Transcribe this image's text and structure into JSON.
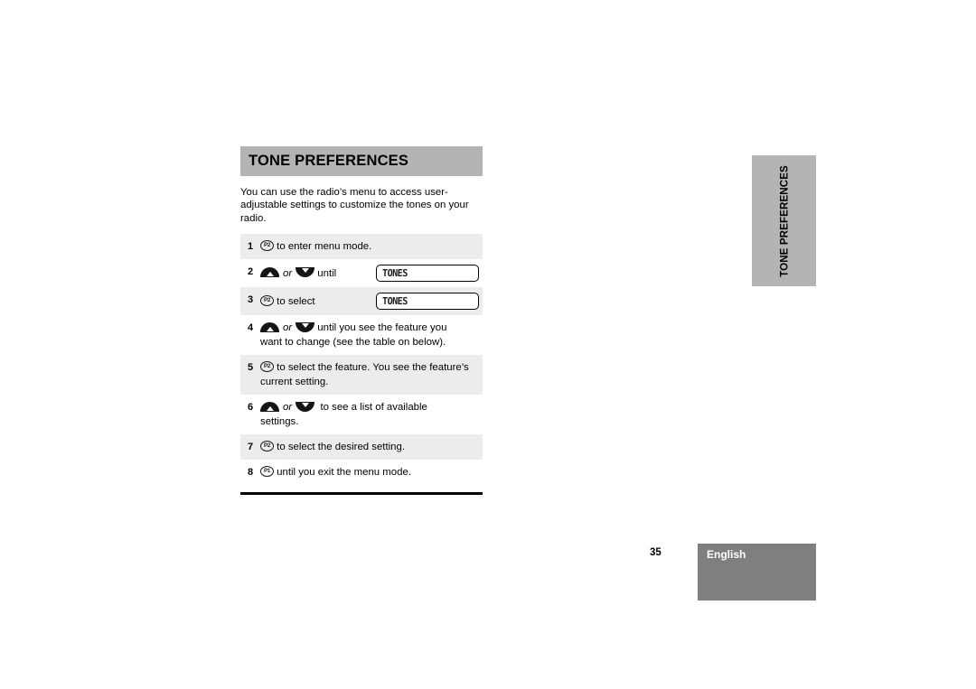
{
  "section": {
    "title": "TONE PREFERENCES",
    "intro": "You can use the radio’s menu to access user-adjustable settings to customize the tones on your radio."
  },
  "side_tab": {
    "label": "TONE PREFERENCES"
  },
  "steps": [
    {
      "num": "1",
      "icon": "p2-button-icon",
      "icon_label": "P2",
      "text": " to enter menu mode.",
      "text2": "",
      "lcd": ""
    },
    {
      "num": "2",
      "icon": "up-down-buttons-icon",
      "icon_label": "",
      "text_or": "or",
      "text": " until ",
      "text2": "",
      "lcd": "TONES"
    },
    {
      "num": "3",
      "icon": "p2-button-icon",
      "icon_label": "P2",
      "text": " to select",
      "text2": "",
      "lcd": "TONES"
    },
    {
      "num": "4",
      "icon": "up-down-buttons-icon",
      "icon_label": "",
      "text_or": "or",
      "text": " until you see the feature you",
      "text2": "want to change (see the table on below).",
      "lcd": ""
    },
    {
      "num": "5",
      "icon": "p2-button-icon",
      "icon_label": "P2",
      "text": " to select the feature. You see the feature’s",
      "text2": "current setting.",
      "lcd": ""
    },
    {
      "num": "6",
      "icon": "up-down-buttons-icon",
      "icon_label": "",
      "text_or": "or",
      "text": "  to see a list of available",
      "text2": "settings.",
      "lcd": ""
    },
    {
      "num": "7",
      "icon": "p2-button-icon",
      "icon_label": "P2",
      "text": " to select the desired setting.",
      "text2": "",
      "lcd": ""
    },
    {
      "num": "8",
      "icon": "p1-button-icon",
      "icon_label": "P1",
      "text": " until you exit the menu mode.",
      "text2": "",
      "lcd": ""
    }
  ],
  "footer": {
    "page_number": "35",
    "language": "English"
  },
  "colors": {
    "header_band": "#b4b4b4",
    "row_shaded": "#ececec",
    "footer_block": "#7f7f7f"
  }
}
